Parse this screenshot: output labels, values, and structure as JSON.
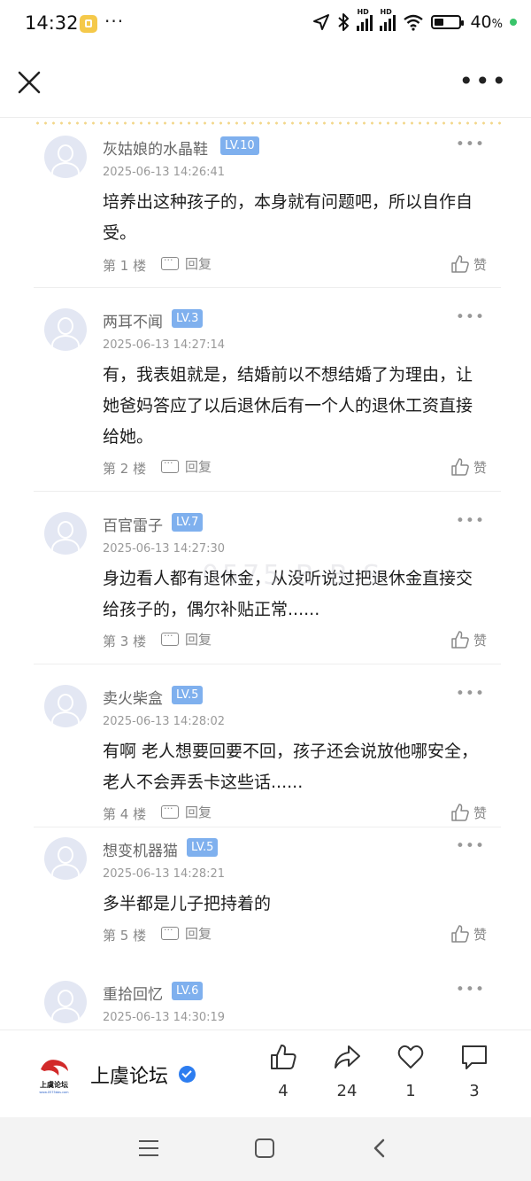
{
  "status_bar": {
    "time": "14:32",
    "notification_dots": "···",
    "battery": "40",
    "battery_unit": "%"
  },
  "header": {
    "close_icon": "close-icon",
    "more_icon": "more-icon"
  },
  "comments": [
    {
      "username": "灰姑娘的水晶鞋",
      "level": "LV.10",
      "time": "2025-06-13 14:26:41",
      "text": "培养出这种孩子的，本身就有问题吧，所以自作自受。",
      "floor": "第 1 楼",
      "reply_label": "回复",
      "like_label": "赞"
    },
    {
      "username": "两耳不闻",
      "level": "LV.3",
      "time": "2025-06-13 14:27:14",
      "text": "有，我表姐就是，结婚前以不想结婚了为理由，让她爸妈答应了以后退休后有一个人的退休工资直接给她。",
      "floor": "第 2 楼",
      "reply_label": "回复",
      "like_label": "赞"
    },
    {
      "username": "百官雷子",
      "level": "LV.7",
      "time": "2025-06-13 14:27:30",
      "text": "身边看人都有退休金，从没听说过把退休金直接交给孩子的，偶尔补贴正常......",
      "floor": "第 3 楼",
      "reply_label": "回复",
      "like_label": "赞"
    },
    {
      "username": "卖火柴盒",
      "level": "LV.5",
      "time": "2025-06-13 14:28:02",
      "text": "有啊 老人想要回要不回，孩子还会说放他哪安全，老人不会弄丢卡这些话......",
      "floor": "第 4 楼",
      "reply_label": "回复",
      "like_label": "赞"
    },
    {
      "username": "想变机器猫",
      "level": "LV.5",
      "time": "2025-06-13 14:28:21",
      "text": "多半都是儿子把持着的",
      "floor": "第 5 楼",
      "reply_label": "回复",
      "like_label": "赞"
    },
    {
      "username": "重拾回忆",
      "level": "LV.6",
      "time": "2025-06-13 14:30:19",
      "text": "",
      "floor": "",
      "reply_label": "",
      "like_label": ""
    }
  ],
  "bottom_bar": {
    "forum_name": "上虞论坛",
    "logo_text": "上虞论坛",
    "logo_url_text": "www.0575bbs.com",
    "like_count": "4",
    "share_count": "24",
    "favorite_count": "1",
    "comment_count": "3"
  },
  "colors": {
    "level_badge": "#7fb0ee",
    "verified_badge": "#2d7df0",
    "battery_dot": "#39c46a"
  }
}
